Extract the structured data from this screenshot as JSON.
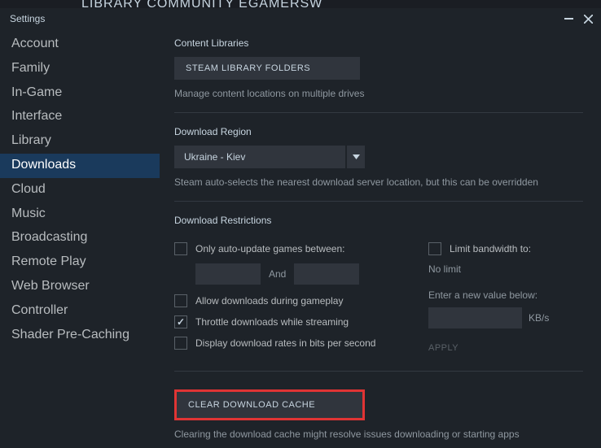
{
  "bg_menu": "LIBRARY   COMMUNITY   EGAMERSW",
  "window": {
    "title": "Settings"
  },
  "sidebar": {
    "items": [
      {
        "label": "Account"
      },
      {
        "label": "Family"
      },
      {
        "label": "In-Game"
      },
      {
        "label": "Interface"
      },
      {
        "label": "Library"
      },
      {
        "label": "Downloads"
      },
      {
        "label": "Cloud"
      },
      {
        "label": "Music"
      },
      {
        "label": "Broadcasting"
      },
      {
        "label": "Remote Play"
      },
      {
        "label": "Web Browser"
      },
      {
        "label": "Controller"
      },
      {
        "label": "Shader Pre-Caching"
      }
    ],
    "active_index": 5
  },
  "content_libraries": {
    "title": "Content Libraries",
    "button": "STEAM LIBRARY FOLDERS",
    "hint": "Manage content locations on multiple drives"
  },
  "download_region": {
    "title": "Download Region",
    "selected": "Ukraine - Kiev",
    "hint": "Steam auto-selects the nearest download server location, but this can be overridden"
  },
  "restrictions": {
    "title": "Download Restrictions",
    "auto_update": {
      "checked": false,
      "label": "Only auto-update games between:"
    },
    "time_and": "And",
    "allow_gameplay": {
      "checked": false,
      "label": "Allow downloads during gameplay"
    },
    "throttle": {
      "checked": true,
      "label": "Throttle downloads while streaming"
    },
    "bits_per_second": {
      "checked": false,
      "label": "Display download rates in bits per second"
    },
    "limit_bandwidth": {
      "checked": false,
      "label": "Limit bandwidth to:"
    },
    "no_limit": "No limit",
    "enter_value": "Enter a new value below:",
    "kbs": "KB/s",
    "apply": "APPLY"
  },
  "clear_cache": {
    "button": "CLEAR DOWNLOAD CACHE",
    "hint": "Clearing the download cache might resolve issues downloading or starting apps"
  }
}
